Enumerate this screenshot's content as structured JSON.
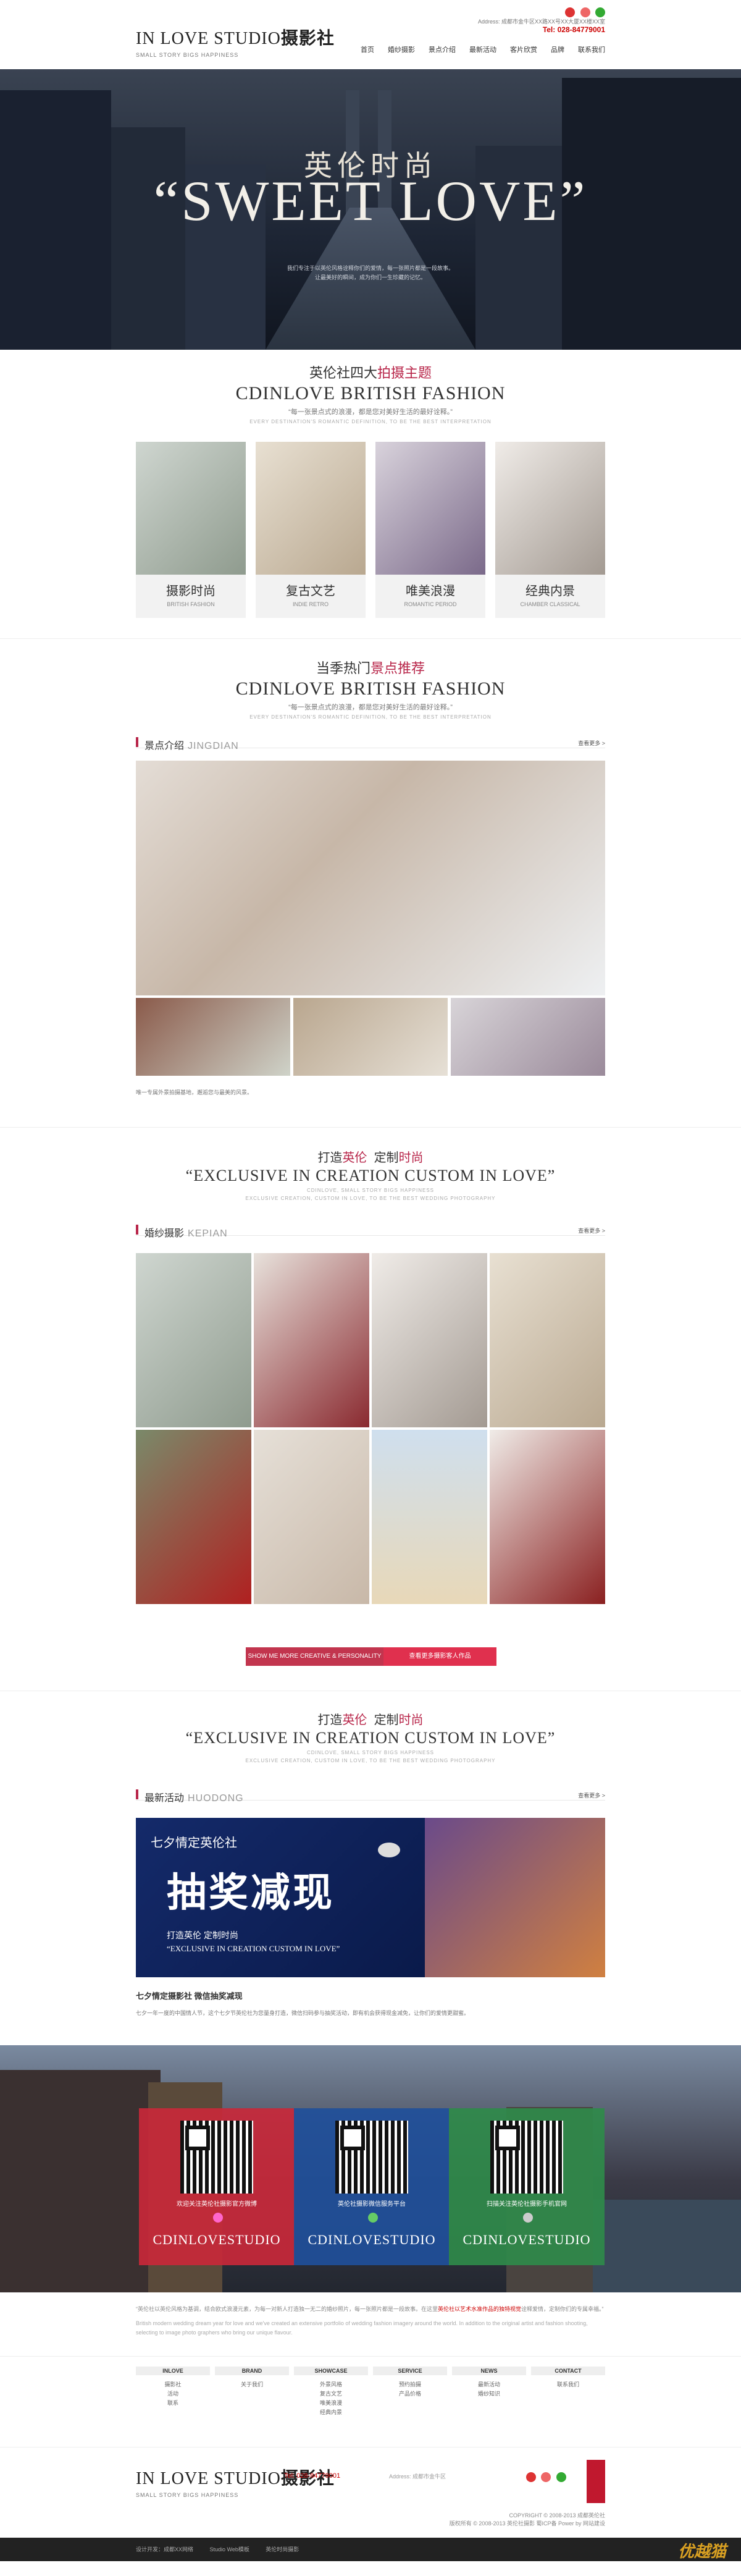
{
  "header": {
    "logo_en": "IN LOVE STUDIO",
    "logo_cn": "摄影社",
    "logo_sub": "SMALL STORY BIGS HAPPINESS",
    "address": "Address: 成都市金牛区XX路XX号XX大厦XX楼XX室",
    "tel": "Tel: 028-84779001"
  },
  "nav": [
    "首页",
    "婚纱摄影",
    "景点介绍",
    "最新活动",
    "客片欣赏",
    "品牌",
    "联系我们"
  ],
  "hero": {
    "title_cn": "英伦时尚",
    "title_en": "“SWEET LOVE”",
    "sub1": "我们专注于以英伦风格诠释你们的爱情，每一张照片都是一段故事。",
    "sub2": "让最美好的瞬间，成为你们一生珍藏的记忆。"
  },
  "themes_section": {
    "cn_prefix": "英伦社四大",
    "cn_em": "拍摄主题",
    "en": "CDINLOVE  BRITISH FASHION",
    "desc": "“每一张景点式的浪漫，都是您对美好生活的最好诠释。”",
    "desc_en": "EVERY DESTINATION'S ROMANTIC DEFINITION, TO BE THE BEST INTERPRETATION"
  },
  "themes": [
    {
      "title": "摄影时尚",
      "sub": "BRITISH FASHION"
    },
    {
      "title": "复古文艺",
      "sub": "INDIE RETRO"
    },
    {
      "title": "唯美浪漫",
      "sub": "ROMANTIC PERIOD"
    },
    {
      "title": "经典内景",
      "sub": "CHAMBER CLASSICAL"
    }
  ],
  "season_section": {
    "cn_prefix": "当季热门",
    "cn_em": "景点推荐",
    "en": "CDINLOVE  BRITISH FASHION",
    "desc": "“每一张景点式的浪漫，都是您对美好生活的最好诠释。”",
    "desc_en": "EVERY DESTINATION'S ROMANTIC DEFINITION, TO BE THE BEST INTERPRETATION"
  },
  "jingdian": {
    "label": "景点介绍",
    "en": "JINGDIAN",
    "more": "查看更多 >",
    "caption": "唯一专属外景拍摄基地，邂逅您与最美的风景。"
  },
  "exclusive1": {
    "cn_a": "打造",
    "cn_em1": "英伦",
    "cn_b": "定制",
    "cn_em2": "时尚",
    "en": "“EXCLUSIVE IN CREATION  CUSTOM IN LOVE”",
    "d1": "CDINLOVE, SMALL STORY BIGS HAPPINESS",
    "d2": "EXCLUSIVE CREATION, CUSTOM IN LOVE, TO BE THE BEST WEDDING PHOTOGRAPHY"
  },
  "kepian": {
    "label": "婚纱摄影",
    "en": "KEPIAN",
    "more": "查看更多 >"
  },
  "buttons": {
    "left": "SHOW ME MORE CREATIVE & PERSONALITY",
    "right": "查看更多摄影客人作品"
  },
  "exclusive2": {
    "cn_a": "打造",
    "cn_em1": "英伦",
    "cn_b": "定制",
    "cn_em2": "时尚",
    "en": "“EXCLUSIVE IN CREATION  CUSTOM IN LOVE”",
    "d1": "CDINLOVE, SMALL STORY BIGS HAPPINESS",
    "d2": "EXCLUSIVE CREATION, CUSTOM IN LOVE, TO BE THE BEST WEDDING PHOTOGRAPHY"
  },
  "huodong": {
    "label": "最新活动",
    "en": "HUODONG",
    "more": "查看更多 >"
  },
  "promo": {
    "top": "七夕情定英伦社",
    "big": "抽奖减现",
    "line1": "打造英伦 定制时尚",
    "line2": "“EXCLUSIVE IN CREATION  CUSTOM IN LOVE”",
    "headline": "七夕情定摄影社 微信抽奖减现",
    "body": "七夕一年一度的中国情人节，这个七夕节英伦社为您量身打造，微信扫码参与抽奖活动，即有机会获得现金减免，让你们的爱情更甜蜜。"
  },
  "qr": [
    {
      "label": "欢迎关注英伦社摄影官方微博",
      "en": "CDINLOVESTUDIO",
      "color": "#c8283a"
    },
    {
      "label": "英伦社摄影微信服务平台",
      "en": "CDINLOVESTUDIO",
      "color": "#1f4f9a"
    },
    {
      "label": "扫描关注英伦社摄影手机官网",
      "en": "CDINLOVESTUDIO",
      "color": "#2f8a4a"
    }
  ],
  "quote": {
    "cn_a": "“英伦社以英伦风格为基调，结合欧式浪漫元素，为每一对新人打造独一无二的婚纱照片，每一张照片都是一段故事。在这里",
    "cn_hl": "英伦社以艺术水准作品的独特视觉",
    "cn_b": "诠释爱情，定制你们的专属幸福。”",
    "en": "British modern wedding dream year for love and we've created an extensive portfolio of wedding fashion imagery around the world. In addition to the original artist and fashion shooting, selecting to image photo graphers who bring our unique flavour."
  },
  "footer_cols": [
    {
      "head": "INLOVE",
      "items": [
        "摄影社",
        "活动",
        "联系"
      ]
    },
    {
      "head": "BRAND",
      "items": [
        "关于我们"
      ]
    },
    {
      "head": "SHOWCASE",
      "items": [
        "外景风格",
        "复古文艺",
        "唯美浪漫",
        "经典内景"
      ]
    },
    {
      "head": "SERVICE",
      "items": [
        "预约拍摄",
        "产品价格"
      ]
    },
    {
      "head": "NEWS",
      "items": [
        "最新活动",
        "婚纱知识"
      ]
    },
    {
      "head": "CONTACT",
      "items": [
        "联系我们"
      ]
    }
  ],
  "footer": {
    "logo_en": "IN LOVE STUDIO",
    "logo_cn": "摄影社",
    "logo_sub": "SMALL STORY BIGS HAPPINESS",
    "tel": "Tel: 028-84779001",
    "addr": "Address: 成都市金牛区",
    "copy1": "COPYRIGHT © 2008-2013 成都英伦社",
    "copy2": "版权所有 © 2008-2013 英伦社摄影 蜀ICP备 Power by 网站建设"
  },
  "bottom_links": [
    "设计开发：成都XX网络",
    "Studio Web模板",
    "英伦时尚摄影"
  ],
  "watermark": "优越猫"
}
